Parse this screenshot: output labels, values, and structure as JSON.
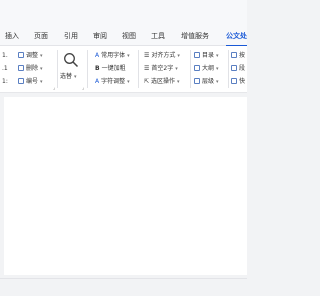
{
  "tabs": [
    {
      "label": "插入",
      "active": false
    },
    {
      "label": "页面",
      "active": false
    },
    {
      "label": "引用",
      "active": false
    },
    {
      "label": "审阅",
      "active": false
    },
    {
      "label": "视图",
      "active": false
    },
    {
      "label": "工具",
      "active": false
    },
    {
      "label": "增值服务",
      "active": false
    },
    {
      "label": "公文处",
      "active": true
    }
  ],
  "ribbon": {
    "left_nums": [
      "1.",
      ".1",
      "1:"
    ],
    "group1": [
      "调整",
      "删除",
      "编号"
    ],
    "search_label": "选替",
    "group2": [
      "常用字体",
      "一键加粗",
      "字符调整"
    ],
    "group2_marks": [
      "A",
      "B",
      "A"
    ],
    "group3": [
      "对齐方式",
      "首空2字",
      "选区操作"
    ],
    "group4": [
      "目录",
      "大纲",
      "层级"
    ],
    "group5": [
      "按",
      "段",
      "快"
    ]
  },
  "colors": {
    "accent": "#1a59d6",
    "icon_blue": "#5a7fc2"
  }
}
